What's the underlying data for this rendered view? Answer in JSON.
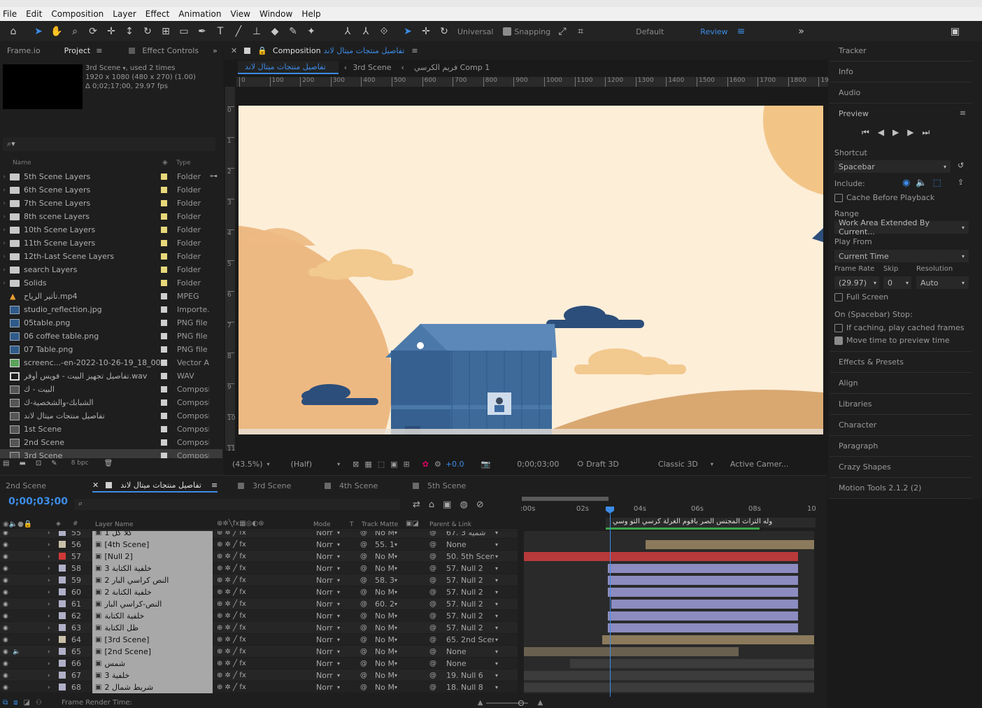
{
  "menu": [
    "File",
    "Edit",
    "Composition",
    "Layer",
    "Effect",
    "Animation",
    "View",
    "Window",
    "Help"
  ],
  "toolbar": {
    "universal": "Universal",
    "snapping": "Snapping",
    "workspaces": [
      "Default",
      "Review"
    ]
  },
  "left_tabs": {
    "frameio": "Frame.io",
    "project": "Project",
    "effect_controls": "Effect Controls"
  },
  "project": {
    "selected_name": "3rd Scene",
    "used": ", used 2 times",
    "resolution": "1920 x 1080  (480 x 270) (1.00)",
    "duration": "Δ 0;02;17;00, 29.97 fps",
    "search_placeholder": "",
    "col_name": "Name",
    "col_type": "Type",
    "bpc": "8 bpc",
    "items": [
      {
        "name": "5th Scene Layers",
        "type": "Folder",
        "icon": "folder-icon",
        "label": "#e8d87a",
        "arrow": true
      },
      {
        "name": "6th Scene Layers",
        "type": "Folder",
        "icon": "folder-icon",
        "label": "#e8d87a",
        "arrow": true
      },
      {
        "name": "7th Scene Layers",
        "type": "Folder",
        "icon": "folder-icon",
        "label": "#e8d87a",
        "arrow": true
      },
      {
        "name": "8th scene Layers",
        "type": "Folder",
        "icon": "folder-icon",
        "label": "#e8d87a",
        "arrow": true
      },
      {
        "name": "10th Scene Layers",
        "type": "Folder",
        "icon": "folder-icon",
        "label": "#e8d87a",
        "arrow": true
      },
      {
        "name": "11th Scene Layers",
        "type": "Folder",
        "icon": "folder-icon",
        "label": "#e8d87a",
        "arrow": true
      },
      {
        "name": "12th-Last Scene Layers",
        "type": "Folder",
        "icon": "folder-icon",
        "label": "#e8d87a",
        "arrow": true
      },
      {
        "name": "search Layers",
        "type": "Folder",
        "icon": "folder-icon",
        "label": "#e8d87a",
        "arrow": true
      },
      {
        "name": "Solids",
        "type": "Folder",
        "icon": "folder-icon",
        "label": "#e8d87a",
        "arrow": true
      },
      {
        "name": "تأثير الرياح.mp4",
        "type": "MPEG",
        "icon": "video-file-icon",
        "label": "#cfcfcf",
        "arrow": false
      },
      {
        "name": "studio_reflection.jpg",
        "type": "Importe...",
        "icon": "image-file-icon",
        "label": "#cfcfcf",
        "arrow": false
      },
      {
        "name": "05table.png",
        "type": "PNG file",
        "icon": "image-file-icon",
        "label": "#cfcfcf",
        "arrow": false
      },
      {
        "name": "06 coffee table.png",
        "type": "PNG file",
        "icon": "image-file-icon",
        "label": "#cfcfcf",
        "arrow": false
      },
      {
        "name": "07 Table.png",
        "type": "PNG file",
        "icon": "image-file-icon",
        "label": "#cfcfcf",
        "arrow": false
      },
      {
        "name": "screenc...-en-2022-10-26-19_18_00.pdf",
        "type": "Vector Ar",
        "icon": "pdf-file-icon",
        "label": "#cfcfcf",
        "arrow": false
      },
      {
        "name": "تفاصيل تجهيز البيت - فويس أوفر.wav",
        "type": "WAV",
        "icon": "audio-file-icon",
        "label": "#cfcfcf",
        "arrow": false
      },
      {
        "name": "البيت - ك",
        "type": "Composi",
        "icon": "composition-icon",
        "label": "#cfcfcf",
        "arrow": false
      },
      {
        "name": "الشبابك-والشخصية-ك",
        "type": "Composi",
        "icon": "composition-icon",
        "label": "#cfcfcf",
        "arrow": false
      },
      {
        "name": "تفاصيل منتجات ميتال لاند",
        "type": "Composi",
        "icon": "composition-icon",
        "label": "#cfcfcf",
        "arrow": false
      },
      {
        "name": "1st Scene",
        "type": "Composi",
        "icon": "composition-icon",
        "label": "#cfcfcf",
        "arrow": false
      },
      {
        "name": "2nd Scene",
        "type": "Composi",
        "icon": "composition-icon",
        "label": "#cfcfcf",
        "arrow": false
      },
      {
        "name": "3rd Scene",
        "type": "Composi",
        "icon": "composition-icon",
        "label": "#cfcfcf",
        "arrow": false,
        "selected": true
      }
    ]
  },
  "comp_panel": {
    "prefix": "Composition",
    "name": "تفاصيل منتجات ميتال لاند",
    "breadcrumb": [
      "تفاصيل منتجات ميتال لاند",
      "3rd Scene",
      "فريم الكرسي Comp 1"
    ],
    "ruler_h": [
      "0",
      "100",
      "200",
      "300",
      "400",
      "500",
      "600",
      "700",
      "800",
      "900",
      "1000",
      "1100",
      "1200",
      "1300",
      "1400",
      "1500",
      "1600",
      "1700",
      "1800",
      "19"
    ],
    "ruler_v": [
      "0",
      "1",
      "2",
      "3",
      "4",
      "5",
      "6",
      "7",
      "8",
      "9",
      "10",
      "11"
    ],
    "zoom": "(43.5%)",
    "resolution": "(Half)",
    "exposure": "+0.0",
    "timecode": "0;00;03;00",
    "draft3d": "Draft 3D",
    "renderer": "Classic 3D",
    "camera": "Active Camer..."
  },
  "right_panel": {
    "tracker": "Tracker",
    "info": "Info",
    "audio": "Audio",
    "preview": "Preview",
    "shortcut_label": "Shortcut",
    "shortcut_value": "Spacebar",
    "include_label": "Include:",
    "cache_before": "Cache Before Playback",
    "range_label": "Range",
    "range_value": "Work Area Extended By Current...",
    "play_from_label": "Play From",
    "play_from_value": "Current Time",
    "frame_rate_label": "Frame Rate",
    "skip_label": "Skip",
    "resolution_label": "Resolution",
    "frame_rate_value": "(29.97)",
    "skip_value": "0",
    "resolution_value": "Auto",
    "full_screen": "Full Screen",
    "stop_label": "On (Spacebar) Stop:",
    "if_caching": "If caching, play cached frames",
    "move_time": "Move time to preview time",
    "panels": [
      "Effects & Presets",
      "Align",
      "Libraries",
      "Character",
      "Paragraph",
      "Crazy Shapes",
      "Motion Tools 2.1.2 (2)"
    ]
  },
  "timeline": {
    "tabs": [
      "2nd Scene",
      "تفاصيل منتجات ميتال لاند",
      "3rd Scene",
      "4th Scene",
      "5th Scene"
    ],
    "timecode": "0;00;03;00",
    "col_layer_name": "Layer Name",
    "col_mode": "Mode",
    "col_t": "T",
    "col_track_matte": "Track Matte",
    "col_parent": "Parent & Link",
    "ruler": [
      ":00s",
      "02s",
      "04s",
      "06s",
      "08s",
      "10"
    ],
    "marker_text": "وله التراث المجنس الصر بأقوم الغرلة كرسي التو وسي",
    "frame_render_label": "Frame Render Time:",
    "layers": [
      {
        "num": "55",
        "name": "1 كلاً كل",
        "label": "#b0b0c8",
        "mode": "Norr",
        "matte": "No M",
        "parent": "67. 3 شميه",
        "partial": true
      },
      {
        "num": "56",
        "name": "[4th Scene]",
        "label": "#c8c0a8",
        "mode": "Norr",
        "matte": "55. 1",
        "parent": "None",
        "bar": {
          "start": 0.42,
          "end": 1.0,
          "color": "#8c7a5c"
        }
      },
      {
        "num": "57",
        "name": "[Null 2]",
        "label": "#d03838",
        "mode": "Norr",
        "matte": "No M",
        "parent": "50. 5th Scene",
        "bar": {
          "start": 0.0,
          "end": 0.945,
          "color": "#b83a3a"
        }
      },
      {
        "num": "58",
        "name": "خلفية الكتابة 3",
        "label": "#b0b0c8",
        "mode": "Norr",
        "matte": "No M",
        "parent": "57. Null 2",
        "bar": {
          "start": 0.29,
          "end": 0.945,
          "color": "#8c8cc0"
        }
      },
      {
        "num": "59",
        "name": "النص كراسي البار 2",
        "label": "#b0b0c8",
        "mode": "Norr",
        "matte": "58. 3",
        "parent": "57. Null 2",
        "bar": {
          "start": 0.29,
          "end": 0.945,
          "color": "#8c8cc0"
        }
      },
      {
        "num": "60",
        "name": "خلفية الكتابة 2",
        "label": "#b0b0c8",
        "mode": "Norr",
        "matte": "No M",
        "parent": "57. Null 2",
        "bar": {
          "start": 0.29,
          "end": 0.945,
          "color": "#8c8cc0"
        }
      },
      {
        "num": "61",
        "name": "النص-كراسي البار",
        "label": "#b0b0c8",
        "mode": "Norr",
        "matte": "60. 2",
        "parent": "57. Null 2",
        "bar": {
          "start": 0.3,
          "end": 0.945,
          "color": "#8c8cc0"
        }
      },
      {
        "num": "62",
        "name": "خلفية الكتابة",
        "label": "#b0b0c8",
        "mode": "Norr",
        "matte": "No M",
        "parent": "57. Null 2",
        "bar": {
          "start": 0.29,
          "end": 0.945,
          "color": "#8c8cc0"
        }
      },
      {
        "num": "63",
        "name": "ظل الكتابة",
        "label": "#b0b0c8",
        "mode": "Norr",
        "matte": "No M",
        "parent": "57. Null 2",
        "bar": {
          "start": 0.29,
          "end": 0.945,
          "color": "#8c8cc0"
        }
      },
      {
        "num": "64",
        "name": "[3rd Scene]",
        "label": "#c8c0a8",
        "mode": "Norr",
        "matte": "No M",
        "parent": "65. 2nd Scene",
        "bar": {
          "start": 0.27,
          "end": 1.0,
          "color": "#8c7a5c"
        }
      },
      {
        "num": "65",
        "name": "[2nd Scene]",
        "label": "#b0b0c8",
        "mode": "Norr",
        "matte": "No M",
        "parent": "None",
        "bar": {
          "start": 0.0,
          "end": 0.74,
          "color": "#6a6050"
        }
      },
      {
        "num": "66",
        "name": "شمس",
        "label": "#b0b0c8",
        "mode": "Norr",
        "matte": "No M",
        "parent": "None",
        "bar": {
          "start": 0.16,
          "end": 1.0,
          "color": "#3c3c3c"
        }
      },
      {
        "num": "67",
        "name": "خلفية 3",
        "label": "#b0b0c8",
        "mode": "Norr",
        "matte": "No M",
        "parent": "19. Null 6",
        "bar": {
          "start": 0.0,
          "end": 1.0,
          "color": "#3c3c3c"
        }
      },
      {
        "num": "68",
        "name": "شريط شمال 2",
        "label": "#b0b0c8",
        "mode": "Norr",
        "matte": "No M",
        "parent": "18. Null 8",
        "bar": {
          "start": 0.0,
          "end": 1.0,
          "color": "#3c3c3c"
        }
      }
    ]
  },
  "colors": {
    "accent": "#3c8ce7",
    "panel": "#1e1e1e",
    "composition_bg": "#fdeed8"
  }
}
